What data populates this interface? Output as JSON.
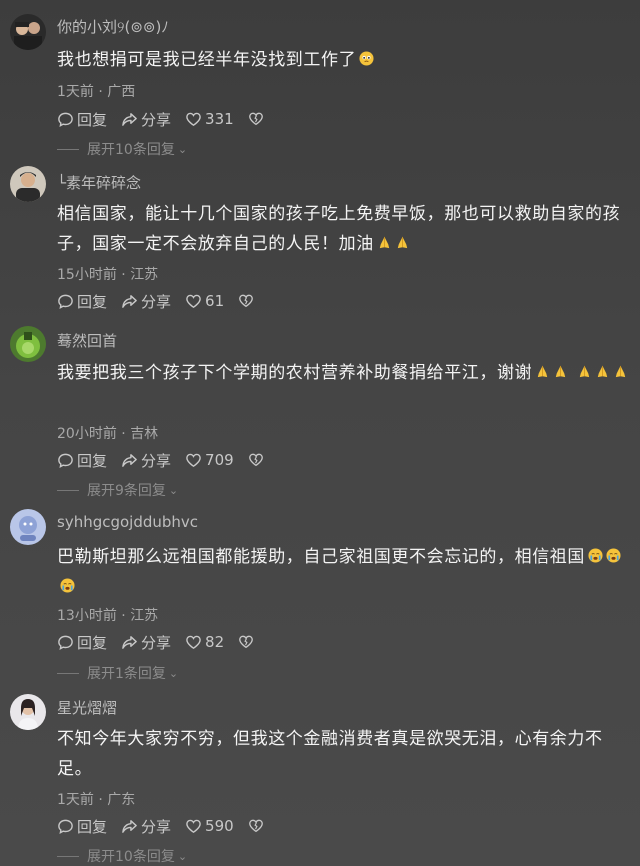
{
  "comments": [
    {
      "username": "你的小刘୨(⊚⊚)ﾉ",
      "text": "我也想捐可是我已经半年没找到工作了",
      "emoji_after": [
        "pleading-face-emoji"
      ],
      "time": "1天前",
      "location": "广西",
      "likes": "331",
      "expand": "展开10条回复"
    },
    {
      "username": "└素年碎碎念",
      "text": "相信国家，能让十几个国家的孩子吃上免费早饭，那也可以救助自家的孩子，国家一定不会放弃自己的人民！加油",
      "emoji_after": [
        "folded-hands-emoji",
        "folded-hands-emoji"
      ],
      "time": "15小时前",
      "location": "江苏",
      "likes": "61",
      "expand": ""
    },
    {
      "username": "蓦然回首",
      "text": "我要把我三个孩子下个学期的农村营养补助餐捐给平江，谢谢",
      "emoji_after": [
        "folded-hands-emoji",
        "folded-hands-emoji",
        "folded-hands-emoji",
        "folded-hands-emoji",
        "folded-hands-emoji"
      ],
      "time": "20小时前",
      "location": "吉林",
      "likes": "709",
      "expand": "展开9条回复"
    },
    {
      "username": "syhhgcgojddubhvc",
      "text": "巴勒斯坦那么远祖国都能援助，自己家祖国更不会忘记的，相信祖国",
      "emoji_after": [
        "crying-face-emoji",
        "crying-face-emoji",
        "crying-face-emoji"
      ],
      "time": "13小时前",
      "location": "江苏",
      "likes": "82",
      "expand": "展开1条回复"
    },
    {
      "username": "星光熠熠",
      "text": "不知今年大家穷不穷，但我这个金融消费者真是欲哭无泪，心有余力不足。",
      "emoji_after": [],
      "time": "1天前",
      "location": "广东",
      "likes": "590",
      "expand": "展开10条回复"
    }
  ],
  "labels": {
    "reply": "回复",
    "share": "分享",
    "separator": "·"
  },
  "colors": {
    "background": "#424242",
    "text": "#f4f4f4",
    "muted": "#a9a9a9",
    "emoji_yellow": "#f5c33b"
  }
}
